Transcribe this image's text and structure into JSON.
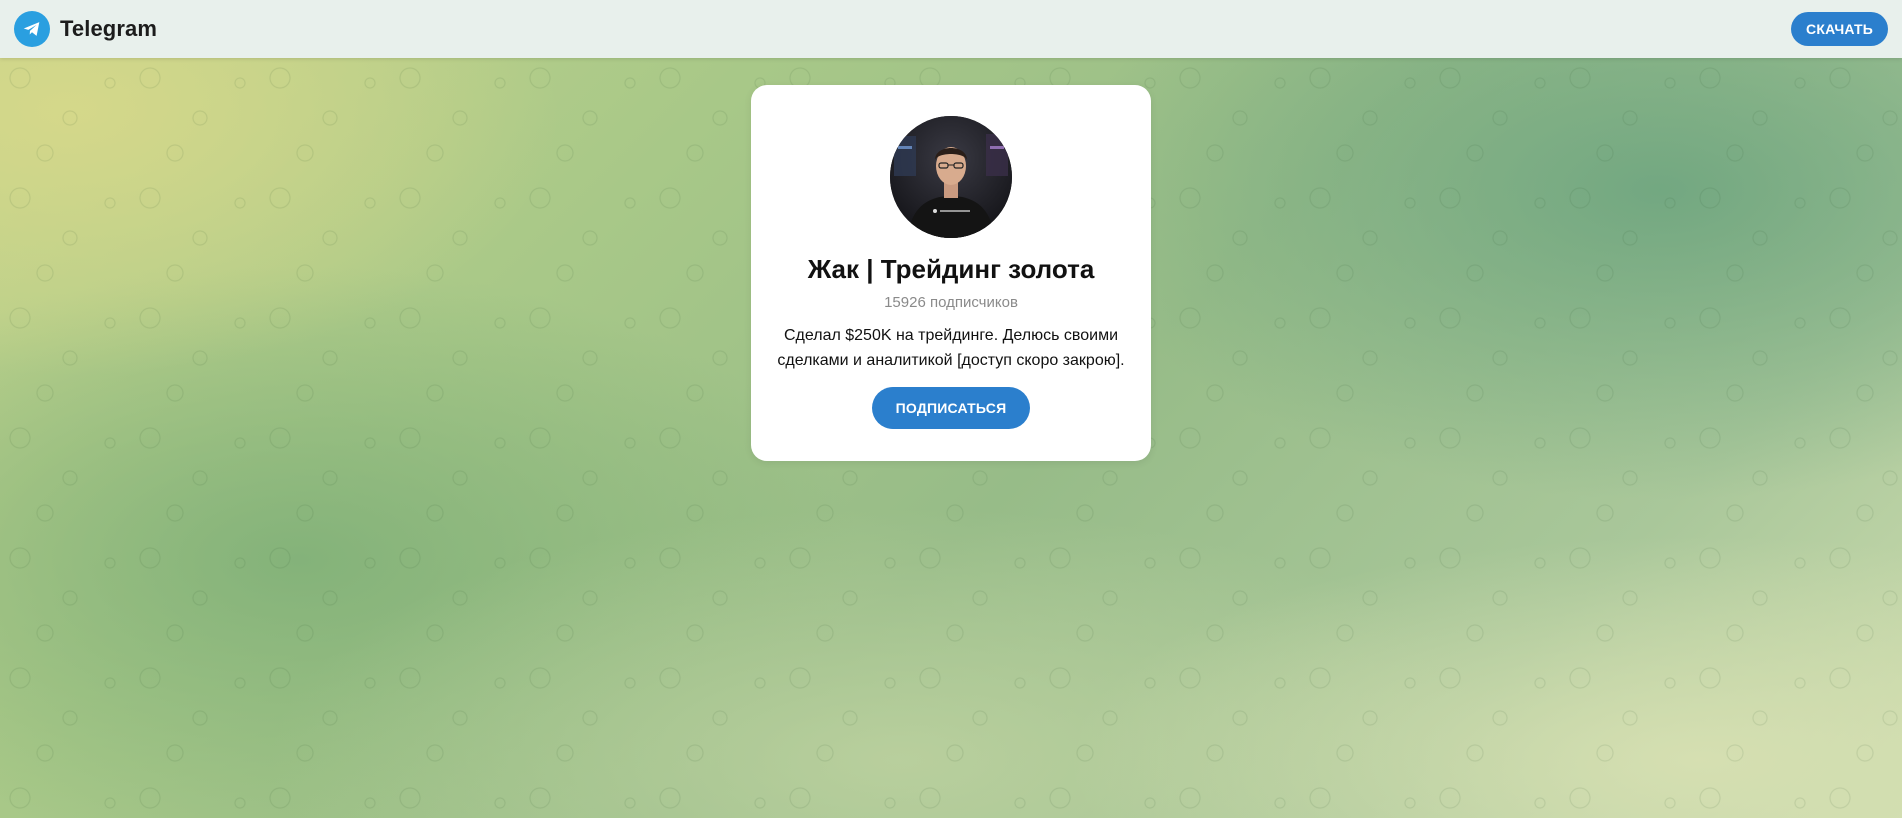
{
  "header": {
    "brand_name": "Telegram",
    "download_label": "СКАЧАТЬ"
  },
  "channel": {
    "title": "Жак | Трейдинг золота",
    "subscribers": "15926 подписчиков",
    "description": "Сделал $250K на трейдинге. Делюсь своими сделками и аналитикой [доступ скоро закрою].",
    "subscribe_label": "ПОДПИСАТЬСЯ"
  },
  "icons": {
    "brand_logo": "telegram-logo-icon",
    "avatar": "channel-avatar-photo"
  },
  "colors": {
    "accent": "#2b7fcd",
    "brand_logo": "#2a9fe0",
    "header_bg": "#e8f0ec",
    "card_bg": "#ffffff"
  }
}
